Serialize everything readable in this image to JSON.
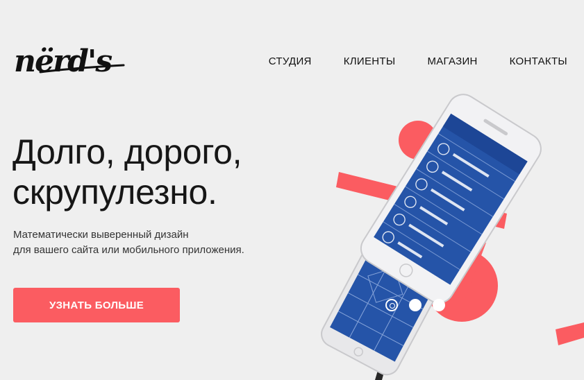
{
  "brand": {
    "logo_text": "nërd's"
  },
  "nav": {
    "items": [
      "СТУДИЯ",
      "КЛИЕНТЫ",
      "МАГАЗИН",
      "КОНТАКТЫ"
    ]
  },
  "hero": {
    "title_line1": "Долго, дорого,",
    "title_line2": "скрупулезно.",
    "subtitle_line1": "Математически выверенный дизайн",
    "subtitle_line2": "для вашего сайта или мобильного приложения.",
    "cta_label": "УЗНАТЬ БОЛЬШЕ"
  },
  "slider": {
    "count": 3,
    "active_index": 0
  },
  "colors": {
    "accent": "#fb5c61",
    "background": "#efefef",
    "screen_blue": "#2554a8"
  }
}
